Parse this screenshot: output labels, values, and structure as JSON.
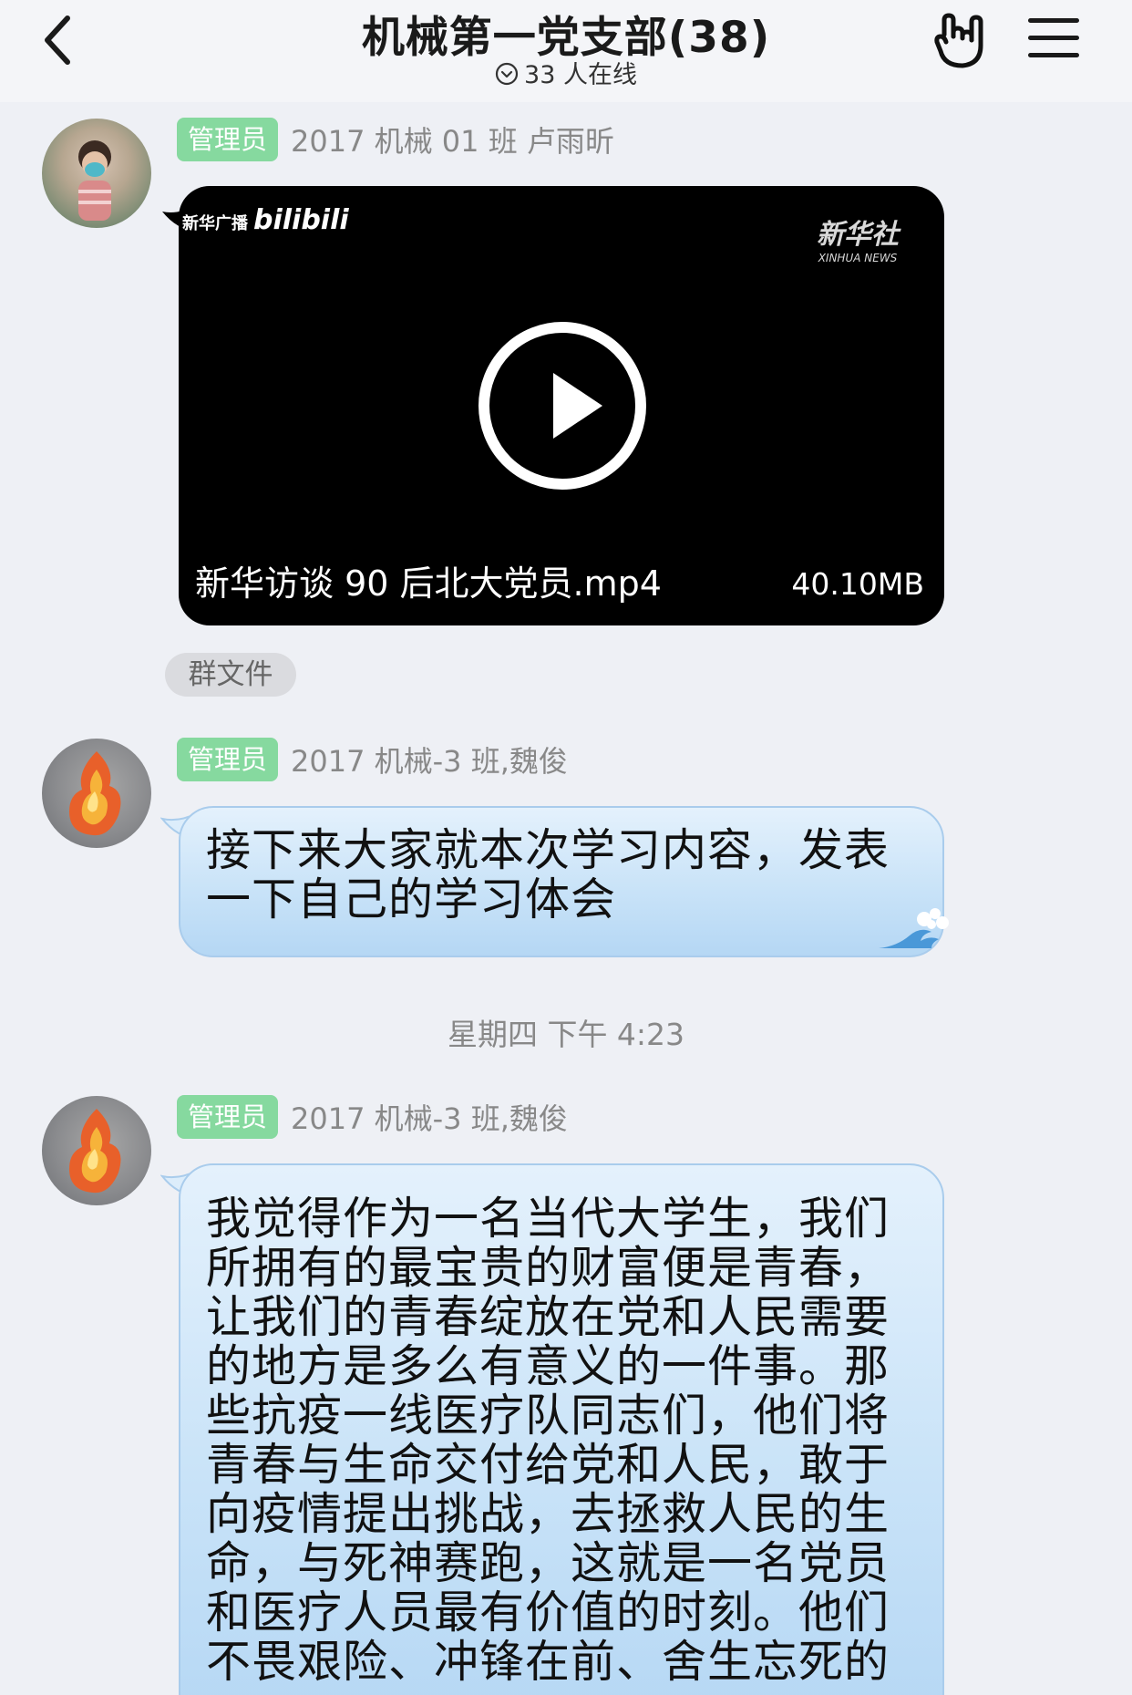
{
  "header": {
    "back_icon": "chevron-left-icon",
    "title": "机械第一党支部(38)",
    "online_icon": "chevron-circle-down-icon",
    "online_text": "33 人在线",
    "gesture_icon": "hand-gesture-icon",
    "menu_icon": "hamburger-menu-icon"
  },
  "messages": [
    {
      "badge": "管理员",
      "sender": "2017 机械 01 班 卢雨昕",
      "video": {
        "source_tag": "新华广播",
        "source_brand": "bilibili",
        "watermark_cn": "新华社",
        "watermark_en": "XINHUA NEWS",
        "filename": "新华访谈 90 后北大党员.mp4",
        "size": "40.10MB"
      },
      "tag": "群文件"
    },
    {
      "badge": "管理员",
      "sender": "2017 机械-3 班,魏俊",
      "text": "接下来大家就本次学习内容，发表一下自己的学习体会"
    },
    {
      "badge": "管理员",
      "sender": "2017 机械-3 班,魏俊",
      "text": "我觉得作为一名当代大学生，我们所拥有的最宝贵的财富便是青春，让我们的青春绽放在党和人民需要的地方是多么有意义的一件事。那些抗疫一线医疗队同志们，他们将青春与生命交付给党和人民，敢于向疫情提出挑战，去拯救人民的生命，与死神赛跑，这就是一名党员和医疗人员最有价值的时刻。他们不畏艰险、冲锋在前、舍生忘死的"
    }
  ],
  "timestamp": "星期四 下午 4:23",
  "colors": {
    "admin_badge": "#86d99f",
    "bubble_top": "#e4f1fc",
    "bubble_bottom": "#b5d7f4",
    "background": "#eef0f5"
  }
}
